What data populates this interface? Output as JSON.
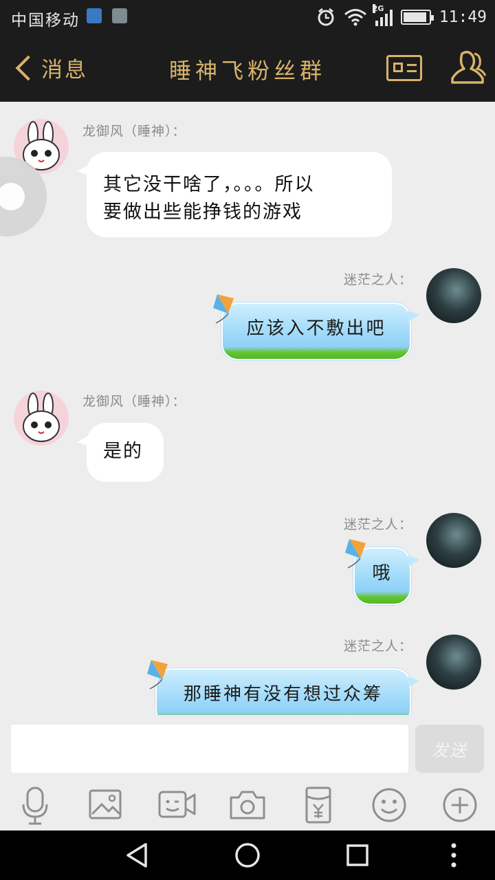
{
  "status_bar": {
    "carrier": "中国移动",
    "network_type": "2G",
    "time": "11:49",
    "battery_level": 0.92,
    "icons": [
      "health-icon",
      "photo-icon",
      "alarm-icon",
      "wifi-icon",
      "signal-icon",
      "battery-icon"
    ]
  },
  "header": {
    "back_label": "消息",
    "title": "睡神飞粉丝群",
    "accent_color": "#d8b36a",
    "icons": [
      "chevron-left-icon",
      "profile-card-icon",
      "group-members-icon"
    ]
  },
  "messages": [
    {
      "side": "left",
      "sender": "龙御风（睡神）：",
      "lines": [
        "其它没干啥了，。。。所以",
        "要做出些能挣钱的游戏"
      ]
    },
    {
      "side": "right",
      "sender": "迷茫之人：",
      "lines": [
        "应该入不敷出吧"
      ]
    },
    {
      "side": "left",
      "sender": "龙御风（睡神）：",
      "lines": [
        "是的"
      ]
    },
    {
      "side": "right",
      "sender": "迷茫之人：",
      "lines": [
        "哦"
      ]
    },
    {
      "side": "right",
      "sender": "迷茫之人：",
      "lines": [
        "那睡神有没有想过众筹"
      ]
    }
  ],
  "input": {
    "value": "",
    "send_label": "发送"
  },
  "toolbar": {
    "icons": [
      "microphone-icon",
      "image-icon",
      "video-call-icon",
      "camera-icon",
      "red-packet-icon",
      "emoji-icon",
      "plus-icon"
    ]
  },
  "navbar": {
    "icons": [
      "back-triangle-icon",
      "home-circle-icon",
      "recents-square-icon",
      "more-dots-icon"
    ]
  }
}
